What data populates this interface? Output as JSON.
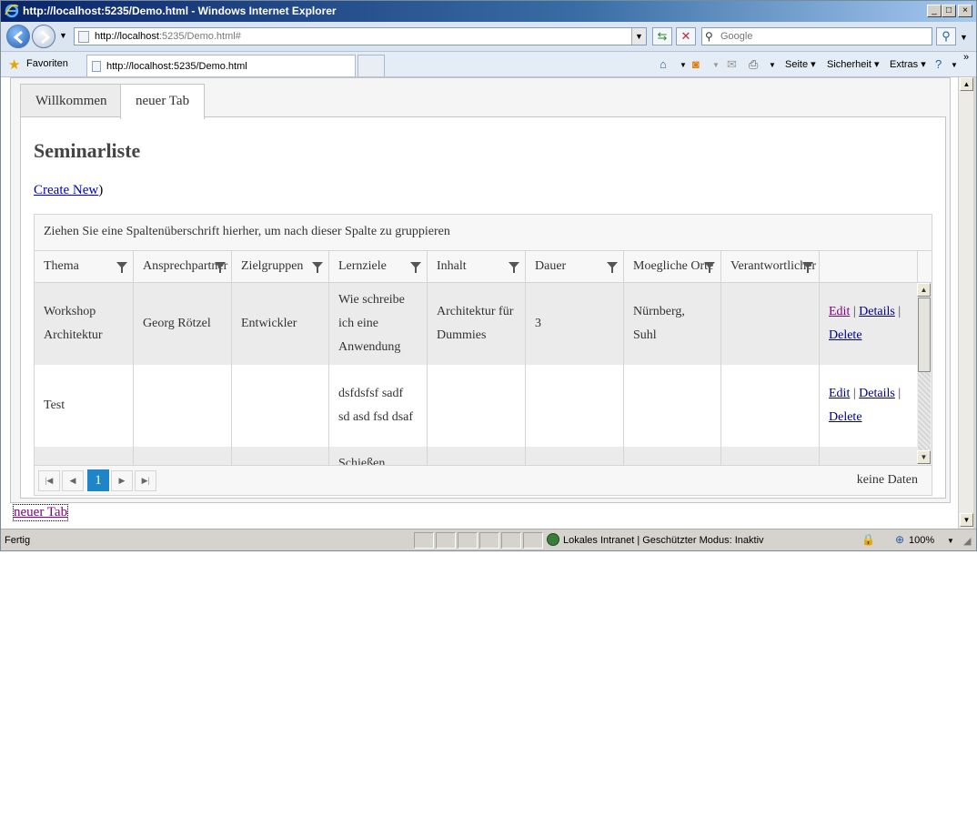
{
  "window": {
    "title": "http://localhost:5235/Demo.html - Windows Internet Explorer",
    "min_label": "_",
    "max_label": "□",
    "close_label": "×"
  },
  "address_bar": {
    "url_host": "http://localhost",
    "url_rest": ":5235/Demo.html#",
    "search_placeholder": "Google"
  },
  "favorites_bar": {
    "favorites_label": "Favoriten",
    "tab_title": "http://localhost:5235/Demo.html",
    "commands": [
      "Seite ▾",
      "Sicherheit ▾",
      "Extras ▾"
    ]
  },
  "page": {
    "tabs": [
      "Willkommen",
      "neuer Tab"
    ],
    "active_tab": 1,
    "heading": "Seminarliste",
    "create_new_label": "Create New",
    "create_new_suffix": ")",
    "footer_link": "neuer Tab"
  },
  "grid": {
    "grouping_hint": "Ziehen Sie eine Spaltenüberschrift hierher, um nach dieser Spalte zu gruppieren",
    "columns": [
      "Thema",
      "Ansprechpartner",
      "Zielgruppen",
      "Lernziele",
      "Inhalt",
      "Dauer",
      "Moegliche Orte",
      "Verantwortlicher",
      ""
    ],
    "rows": [
      {
        "thema": "Workshop Architektur",
        "ansprechpartner": "Georg Rötzel",
        "zielgruppen": "Entwickler",
        "lernziele": "Wie schreibe ich eine Anwendung",
        "inhalt": "Architektur für Dummies",
        "dauer": "3",
        "orte": "Nürnberg, Suhl",
        "verantwortlicher": ""
      },
      {
        "thema": "Test",
        "ansprechpartner": "",
        "zielgruppen": "",
        "lernziele": "dsfdsfsf sadf sd asd fsd dsaf",
        "inhalt": "",
        "dauer": "",
        "orte": "",
        "verantwortlicher": ""
      },
      {
        "thema": "",
        "ansprechpartner": "",
        "zielgruppen": "",
        "lernziele": "Schießen",
        "inhalt": "",
        "dauer": "",
        "orte": "",
        "verantwortlicher": ""
      }
    ],
    "action_edit": "Edit",
    "action_details": "Details",
    "action_delete": "Delete",
    "action_sep": "|",
    "current_page": "1",
    "no_data": "keine Daten"
  },
  "status_bar": {
    "status": "Fertig",
    "zone": "Lokales Intranet | Geschützter Modus: Inaktiv",
    "zoom": "100%"
  },
  "colors": {
    "pager_active": "#1f85c9",
    "row_alt": "#ebebeb",
    "link": "#000088",
    "link_visited": "#800080"
  }
}
